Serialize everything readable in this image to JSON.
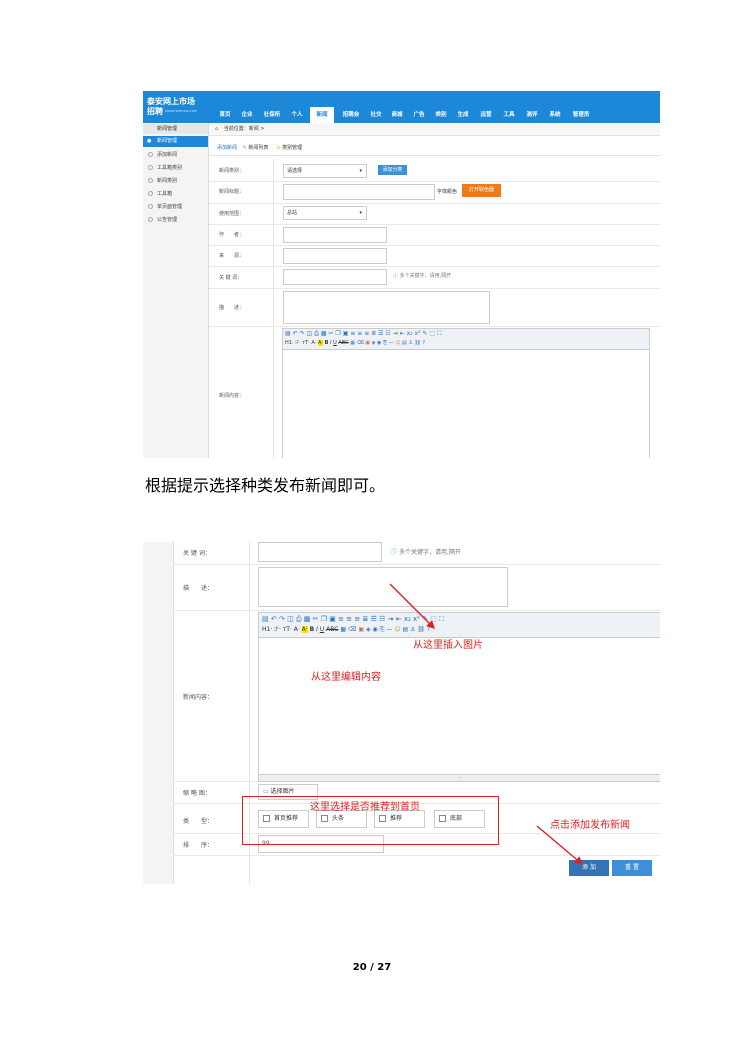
{
  "shot1": {
    "logo_line1": "泰安网上市场",
    "logo_line2": "招聘",
    "logo_sub": "www.tarencai.com",
    "nav": [
      "首页",
      "企业",
      "社保所",
      "个人",
      "新闻",
      "招聘会",
      "社交",
      "商城",
      "广告",
      "类别",
      "生成",
      "运营",
      "工具",
      "测评",
      "系统",
      "管理员"
    ],
    "nav_active": 4,
    "side_head": "新闻管理",
    "side_active": "新闻管理",
    "side_items": [
      "添加新闻",
      "工具箱类别",
      "新闻类别",
      "工具箱",
      "单页面管理",
      "公告管理"
    ],
    "breadcrumb": "当前位置：新闻 >",
    "tabs": [
      "添加新闻",
      "新闻列表",
      "类别管理"
    ],
    "fields": {
      "category_label": "新闻类别：",
      "category_value": "请选择",
      "add_category": "添加分类",
      "title_label": "新闻标题：",
      "font_color_label": "字体颜色",
      "color_picker": "打开取色器",
      "scope_label": "使用范围：",
      "scope_value": "总站",
      "author_label": "作　　者：",
      "source_label": "来　　源：",
      "keywords_label": "关 键 词：",
      "keywords_hint": "多个关键字，请用,隔开",
      "desc_label": "描　　述：",
      "content_label": "新闻内容："
    },
    "toolbar_row2": [
      "H1·",
      "ℱ·",
      "тT·",
      "A·",
      "A·",
      "B",
      "I",
      "U",
      "ABC"
    ]
  },
  "caption": "根据提示选择种类发布新闻即可。",
  "shot2": {
    "keywords_label": "关 键 词：",
    "keywords_hint": "多个关键字，请用,隔开",
    "desc_label": "描　　述：",
    "content_label": "新闻内容：",
    "annot_image": "从这里插入图片",
    "annot_edit": "从这里编辑内容",
    "thumb_label": "缩 略 图：",
    "upload_btn": "选择图片",
    "type_label": "类　　型：",
    "annot_type": "这里选择是否推荐到首页",
    "types": [
      "首页推荐",
      "头条",
      "推荐",
      "底部"
    ],
    "sort_label": "排　　序：",
    "sort_value": "99",
    "annot_submit": "点击添加发布新闻",
    "add_btn": "添 加",
    "reset_btn": "重 置",
    "toolbar_row2": [
      "H1·",
      "ℱ·",
      "тT·",
      "A·",
      "A·",
      "B",
      "I",
      "U",
      "ABC"
    ]
  },
  "page_number": "20 / 27",
  "colors": {
    "accent": "#1e88d8",
    "annotation": "#e02020",
    "orange": "#f07a18"
  }
}
